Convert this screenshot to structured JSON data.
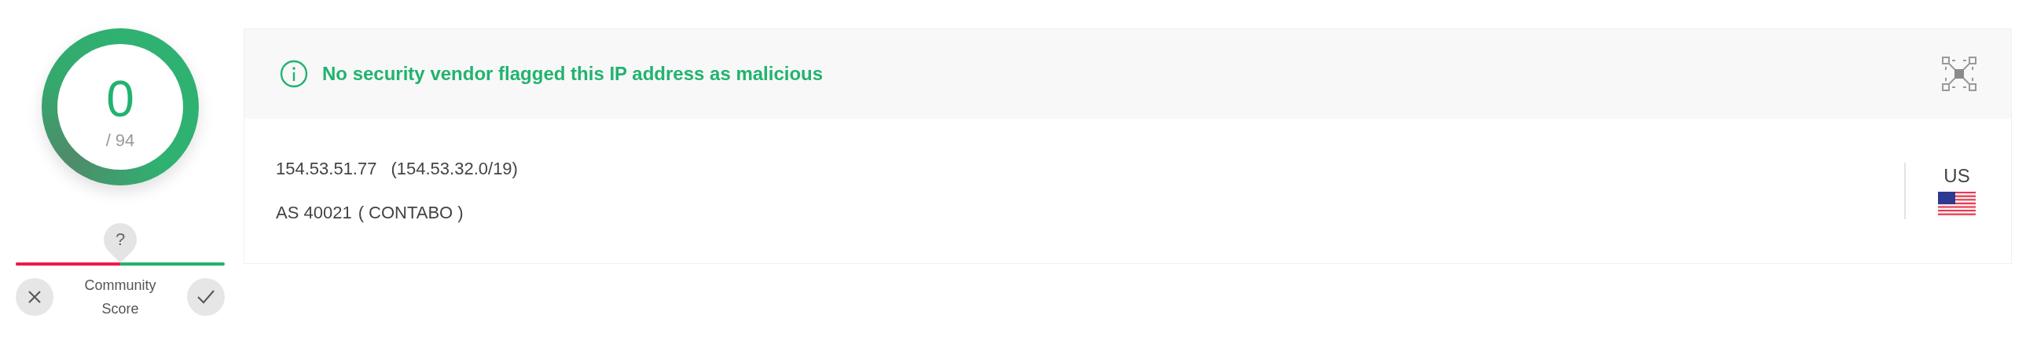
{
  "detection": {
    "malicious": "0",
    "total": "/ 94"
  },
  "community": {
    "marker": "?",
    "level": 0.5,
    "label": "Community Score"
  },
  "banner": {
    "message": "No security vendor flagged this IP address as malicious"
  },
  "details": {
    "ip": "154.53.51.77",
    "network": "(154.53.32.0/19)",
    "asn": "AS 40021",
    "owner": "( CONTABO )",
    "country": "US"
  }
}
